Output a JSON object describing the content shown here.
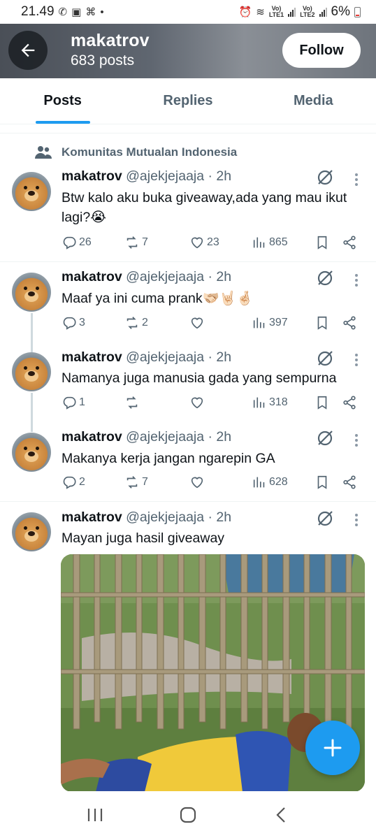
{
  "status_bar": {
    "time": "21.49",
    "net1": "Vo)\nLTE1",
    "net2": "Vo)\nLTE2",
    "battery": "6%"
  },
  "header": {
    "name": "makatrov",
    "post_count": "683 posts",
    "follow_label": "Follow"
  },
  "tabs": [
    {
      "label": "Posts",
      "active": true
    },
    {
      "label": "Replies",
      "active": false
    },
    {
      "label": "Media",
      "active": false
    }
  ],
  "community_label": "Komunitas Mutualan Indonesia",
  "tweets": [
    {
      "name": "makatrov",
      "handle": "@ajekjejaaja · 2h",
      "text": "Btw kalo aku buka giveaway,ada yang mau ikut lagi?😭",
      "replies": "26",
      "reposts": "7",
      "likes": "23",
      "views": "865"
    },
    {
      "name": "makatrov",
      "handle": "@ajekjejaaja · 2h",
      "text": "Maaf ya ini cuma prank🫱🏻‍🫲🏼🤘🏻🤞🏻",
      "replies": "3",
      "reposts": "2",
      "likes": "",
      "views": "397"
    },
    {
      "name": "makatrov",
      "handle": "@ajekjejaaja · 2h",
      "text": "Namanya juga manusia gada yang sempurna",
      "replies": "1",
      "reposts": "",
      "likes": "",
      "views": "318"
    },
    {
      "name": "makatrov",
      "handle": "@ajekjejaaja · 2h",
      "text": "Makanya kerja jangan ngarepin GA",
      "replies": "2",
      "reposts": "7",
      "likes": "",
      "views": "628"
    },
    {
      "name": "makatrov",
      "handle": "@ajekjejaaja · 2h",
      "text": "Mayan juga hasil giveaway"
    }
  ],
  "icons": [
    "back-arrow-icon",
    "community-icon",
    "grok-icon",
    "more-icon",
    "reply-icon",
    "repost-icon",
    "like-icon",
    "views-icon",
    "bookmark-icon",
    "share-icon",
    "compose-plus-icon",
    "recents-icon",
    "home-icon",
    "back-icon"
  ],
  "colors": {
    "accent": "#1d9bf0",
    "secondary_text": "#536471",
    "primary_text": "#0f1419"
  }
}
